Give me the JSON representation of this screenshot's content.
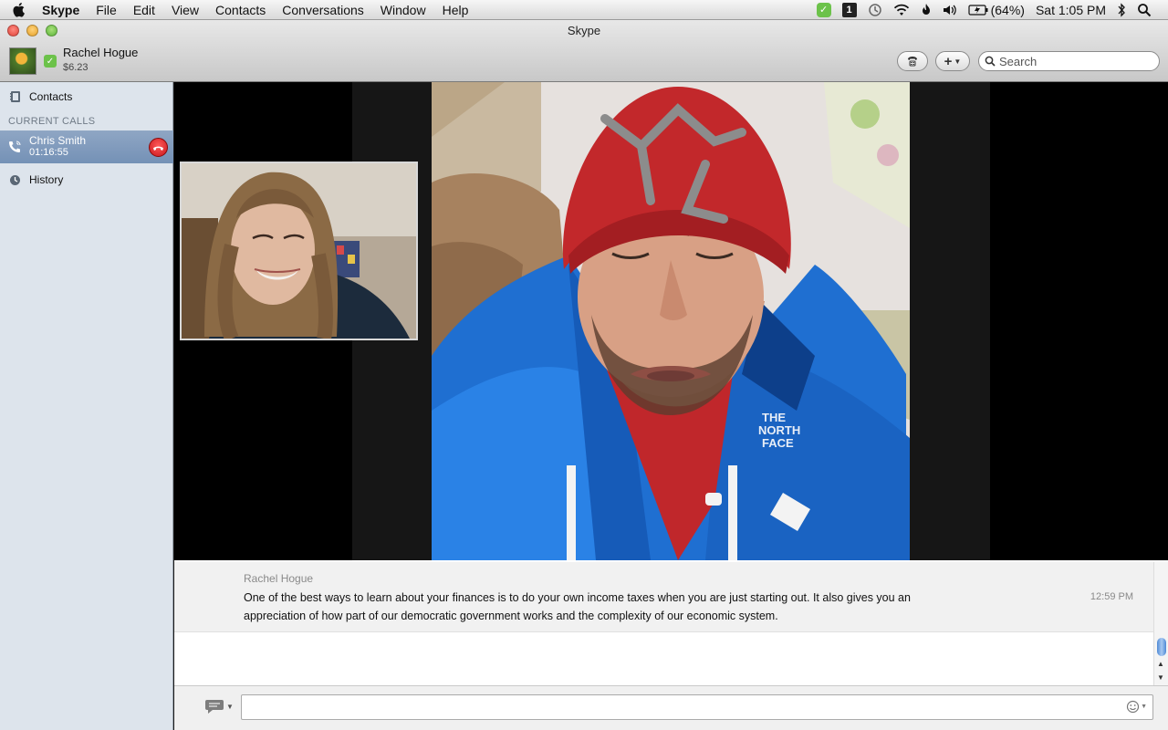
{
  "menubar": {
    "app_name": "Skype",
    "items": [
      "File",
      "Edit",
      "View",
      "Contacts",
      "Conversations",
      "Window",
      "Help"
    ],
    "battery": "(64%)",
    "clock": "Sat 1:05 PM"
  },
  "window": {
    "title": "Skype"
  },
  "profile": {
    "name": "Rachel Hogue",
    "credit": "$6.23"
  },
  "search": {
    "placeholder": "Search"
  },
  "sidebar": {
    "contacts_label": "Contacts",
    "current_calls_header": "CURRENT CALLS",
    "call": {
      "name": "Chris Smith",
      "duration": "01:16:55"
    },
    "history_label": "History"
  },
  "chat": {
    "message": {
      "author": "Rachel Hogue",
      "text": "One of the best ways to learn about your finances is to do your own income taxes when you are just starting out. It also gives you an appreciation of how part of our democratic government works and the complexity of our economic system.",
      "time": "12:59 PM"
    }
  },
  "colors": {
    "skype_status_green": "#6cc24a",
    "sidebar_bg": "#dde4ec",
    "selected_call_bg": "#7f9abd",
    "hangup_red": "#d9252b"
  },
  "icons": [
    "apple-icon",
    "skype-status-icon",
    "wifi-icon",
    "volume-icon",
    "bluetooth-icon",
    "spotlight-icon",
    "dialpad-icon",
    "add-icon",
    "search-icon",
    "contacts-book-icon",
    "phone-icon",
    "hangup-icon",
    "clock-icon",
    "chat-bubble-icon",
    "emoticon-icon"
  ]
}
